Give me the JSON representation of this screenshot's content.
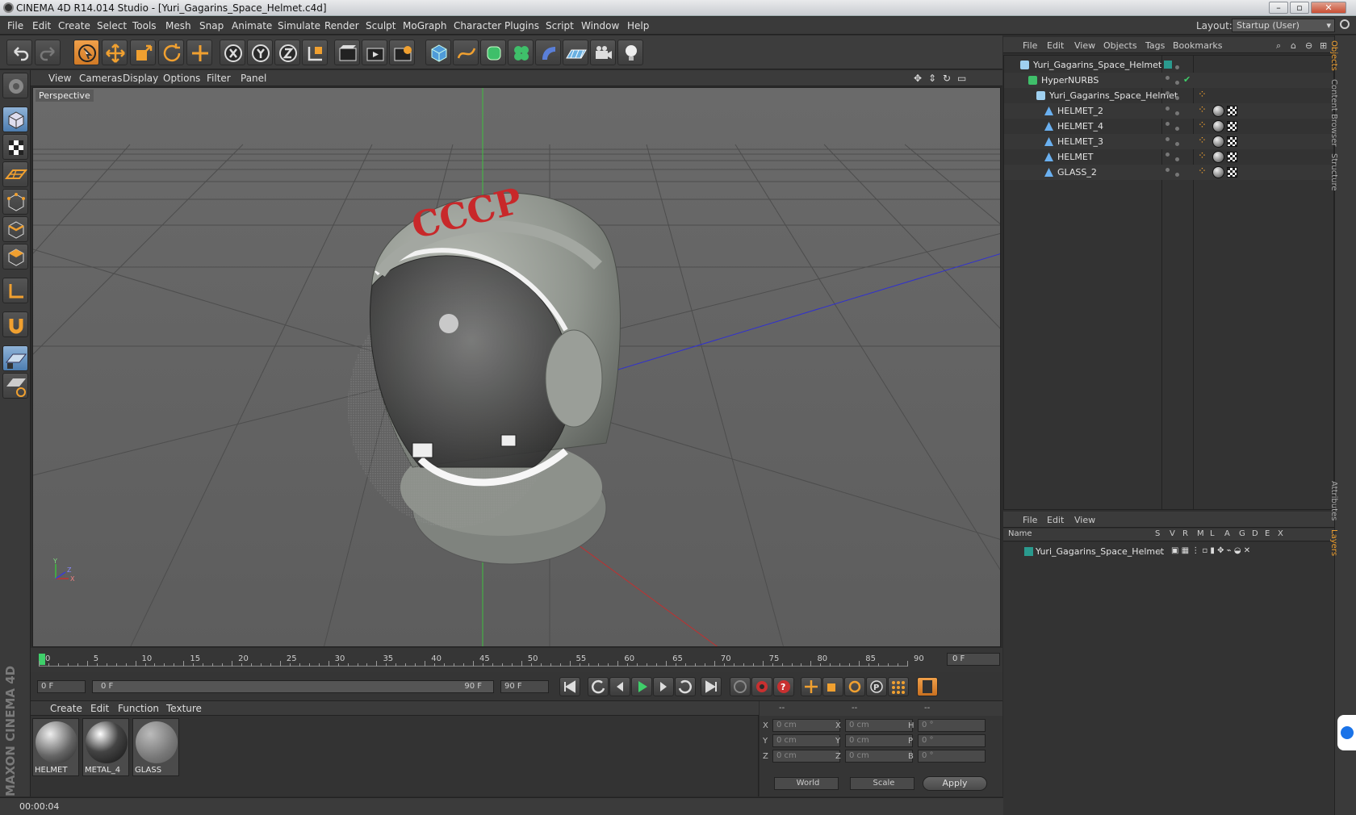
{
  "window": {
    "title": "CINEMA 4D R14.014 Studio - [Yuri_Gagarins_Space_Helmet.c4d]"
  },
  "menu": [
    "File",
    "Edit",
    "Create",
    "Select",
    "Tools",
    "Mesh",
    "Snap",
    "Animate",
    "Simulate",
    "Render",
    "Sculpt",
    "MoGraph",
    "Character",
    "Plugins",
    "Script",
    "Window",
    "Help"
  ],
  "layout": {
    "label": "Layout:",
    "value": "Startup (User)"
  },
  "viewport": {
    "menu": [
      "View",
      "Cameras",
      "Display",
      "Options",
      "Filter",
      "Panel"
    ],
    "camera_label": "Perspective",
    "helmet_text": "CCCP",
    "axis_labels": {
      "y": "Y",
      "x": "X",
      "z": "Z"
    }
  },
  "timeline": {
    "ticks": [
      "0",
      "5",
      "10",
      "15",
      "20",
      "25",
      "30",
      "35",
      "40",
      "45",
      "50",
      "55",
      "60",
      "65",
      "70",
      "75",
      "80",
      "85",
      "90"
    ],
    "current_frame": "0 F"
  },
  "transport": {
    "start_field": "0 F",
    "range_start": "0 F",
    "range_end": "90 F",
    "end_field": "90 F"
  },
  "materials": {
    "menu": [
      "Create",
      "Edit",
      "Function",
      "Texture"
    ],
    "items": [
      {
        "name": "HELMET"
      },
      {
        "name": "METAL_4"
      },
      {
        "name": "GLASS"
      }
    ]
  },
  "coords": {
    "headers": [
      "--",
      "--",
      "--"
    ],
    "rows": [
      {
        "a_label": "X",
        "a_value": "0 cm",
        "b_label": "X",
        "b_value": "0 cm",
        "c_label": "H",
        "c_value": "0 °"
      },
      {
        "a_label": "Y",
        "a_value": "0 cm",
        "b_label": "Y",
        "b_value": "0 cm",
        "c_label": "P",
        "c_value": "0 °"
      },
      {
        "a_label": "Z",
        "a_value": "0 cm",
        "b_label": "Z",
        "b_value": "0 cm",
        "c_label": "B",
        "c_value": "0 °"
      }
    ],
    "mode_select": "World",
    "scale_select": "Scale",
    "apply_label": "Apply"
  },
  "objects": {
    "menu": [
      "File",
      "Edit",
      "View",
      "Objects",
      "Tags",
      "Bookmarks"
    ],
    "rows": [
      {
        "name": "Yuri_Gagarins_Space_Helmet",
        "level": 0,
        "icon": "null-icon"
      },
      {
        "name": "HyperNURBS",
        "level": 1,
        "icon": "hypernurbs-icon"
      },
      {
        "name": "Yuri_Gagarins_Space_Helmet",
        "level": 2,
        "icon": "null-icon"
      },
      {
        "name": "HELMET_2",
        "level": 3,
        "icon": "polygon-icon"
      },
      {
        "name": "HELMET_4",
        "level": 3,
        "icon": "polygon-icon"
      },
      {
        "name": "HELMET_3",
        "level": 3,
        "icon": "polygon-icon"
      },
      {
        "name": "HELMET",
        "level": 3,
        "icon": "polygon-icon"
      },
      {
        "name": "GLASS_2",
        "level": 3,
        "icon": "polygon-icon"
      }
    ]
  },
  "layers": {
    "menu": [
      "File",
      "Edit",
      "View"
    ],
    "columns": [
      "Name",
      "S",
      "V",
      "R",
      "M",
      "L",
      "A",
      "G",
      "D",
      "E",
      "X"
    ],
    "rows": [
      {
        "name": "Yuri_Gagarins_Space_Helmet",
        "color": "#2a9a8e"
      }
    ]
  },
  "right_tabs": [
    "Objects",
    "Content Browser",
    "Structure",
    "Attributes",
    "Layers"
  ],
  "status": {
    "text": "00:00:04"
  },
  "colors": {
    "accent_orange": "#e8892f",
    "active_blue": "#5d8ec2",
    "timeline_marker": "#3fcf6a",
    "helmet_red": "#c8282a"
  }
}
